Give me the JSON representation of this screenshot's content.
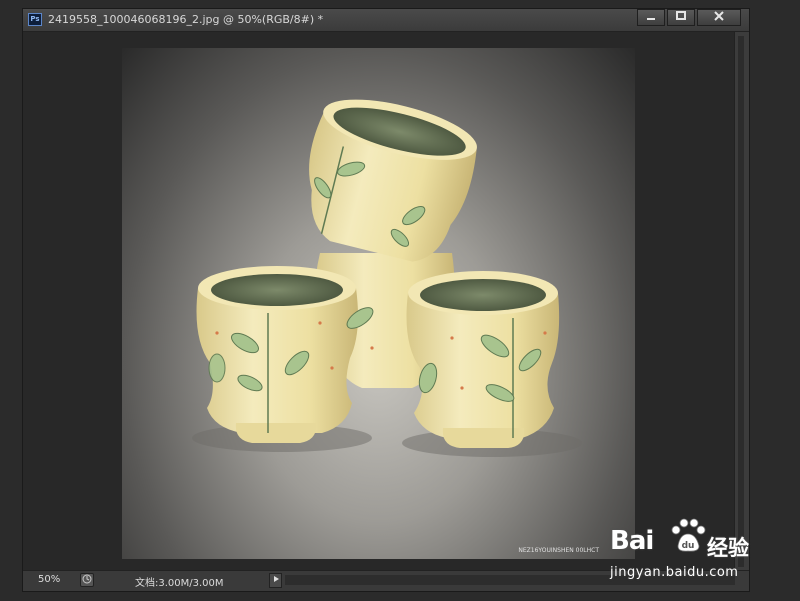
{
  "app": {
    "icon_label": "Ps",
    "title": "2419558_100046068196_2.jpg @ 50%(RGB/8#) *"
  },
  "window_buttons": {
    "minimize_icon": "minimize-icon",
    "maximize_icon": "maximize-icon",
    "close_icon": "close-icon"
  },
  "canvas": {
    "image_caption": "NEZ16YOUINSHEN 00LHCT"
  },
  "status": {
    "zoom": "50%",
    "doc_size": "文档:3.00M/3.00M"
  },
  "watermark": {
    "logo": "Bai",
    "brand": "经验",
    "url": "jingyan.baidu.com"
  },
  "colors": {
    "background": "#2b2b2b",
    "window": "#3a3a3a",
    "ceramic": "#efe4a8",
    "leaf": "#a8c48e"
  }
}
